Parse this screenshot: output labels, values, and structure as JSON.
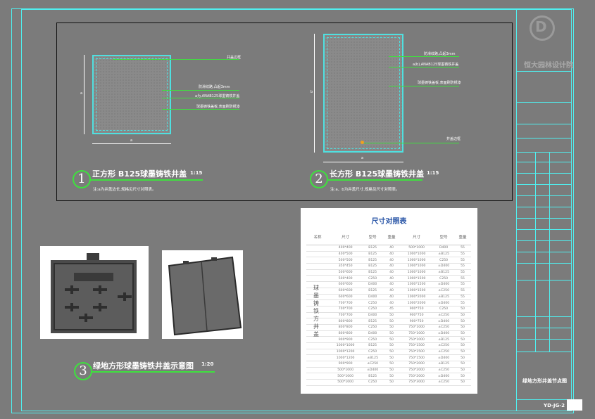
{
  "drawing": {
    "detail1": {
      "number": "1",
      "title": "正方形 B125球墨铸铁井盖",
      "scale": "1:15",
      "note": "注:a为井盖边长,规格见尺寸对照表。",
      "labels": {
        "top": "井盖边框",
        "mid1": "防滑纹路,凸起3mm",
        "mid2": "a为,ANAB125球墨铸铁井盖",
        "mid3": "球墨铸铁盖板,表面刷防锈漆"
      },
      "dims": {
        "side": "a",
        "bottom": "a"
      }
    },
    "detail2": {
      "number": "2",
      "title": "长方形 B125球墨铸铁井盖",
      "scale": "1:15",
      "note": "注:a、b为井盖尺寸,规格见尺寸对照表。",
      "labels": {
        "top": "防滑纹路,凸起3mm",
        "mid1": "a(b),ANAB125球墨铸铁井盖",
        "mid2": "球墨铸铁盖板,表面刷防锈漆",
        "bottom": "井盖边框"
      },
      "dims": {
        "side": "b",
        "bottom": "a"
      }
    },
    "detail3": {
      "number": "3",
      "title": "绿地方形球墨铸铁井盖示意图",
      "scale": "1:20"
    }
  },
  "table": {
    "title": "尺寸对照表",
    "headers": [
      "名称",
      "尺寸",
      "型号",
      "重量",
      "尺寸",
      "型号",
      "重量"
    ],
    "category": "球墨铸铁方井盖",
    "rows": [
      [
        "400*400",
        "B125",
        "40",
        "500*1000",
        "D400",
        "55"
      ],
      [
        "400*500",
        "B125",
        "40",
        "1000*1000",
        "±B125",
        "55"
      ],
      [
        "500*500",
        "B125",
        "40",
        "1000*1000",
        "C250",
        "55"
      ],
      [
        "350*450",
        "B125",
        "40",
        "1000*1000",
        "±D400",
        "55"
      ],
      [
        "500*600",
        "B125",
        "40",
        "1000*1000",
        "±B125",
        "55"
      ],
      [
        "500*400",
        "C250",
        "40",
        "1000*1500",
        "C250",
        "55"
      ],
      [
        "600*600",
        "D400",
        "40",
        "1000*1500",
        "±D400",
        "55"
      ],
      [
        "600*600",
        "B125",
        "40",
        "1000*1500",
        "±C250",
        "55"
      ],
      [
        "600*600",
        "D400",
        "40",
        "1000*2000",
        "±B125",
        "55"
      ],
      [
        "700*700",
        "C250",
        "40",
        "1000*2000",
        "±D400",
        "55"
      ],
      [
        "700*700",
        "C250",
        "45",
        "900*750",
        "C250",
        "50"
      ],
      [
        "700*700",
        "D400",
        "50",
        "900*750",
        "±C250",
        "50"
      ],
      [
        "800*800",
        "B125",
        "50",
        "900*750",
        "±D400",
        "50"
      ],
      [
        "800*800",
        "C250",
        "50",
        "750*1000",
        "±C250",
        "50"
      ],
      [
        "800*800",
        "D400",
        "50",
        "750*1000",
        "±D400",
        "50"
      ],
      [
        "900*900",
        "C250",
        "50",
        "750*1000",
        "±B125",
        "50"
      ],
      [
        "1000*1000",
        "B125",
        "50",
        "750*1500",
        "±C250",
        "50"
      ],
      [
        "1000*1200",
        "C250",
        "50",
        "750*1500",
        "±C250",
        "50"
      ],
      [
        "1000*1200",
        "±B125",
        "50",
        "750*1500",
        "±D400",
        "50"
      ],
      [
        "900*900",
        "±C250",
        "50",
        "750*2000",
        "±B125",
        "50"
      ],
      [
        "500*1000",
        "±D400",
        "50",
        "750*2000",
        "±C250",
        "50"
      ],
      [
        "500*1000",
        "B125",
        "50",
        "750*2000",
        "±D400",
        "50"
      ],
      [
        "500*1000",
        "C250",
        "50",
        "750*3000",
        "±C250",
        "50"
      ]
    ]
  },
  "title_block": {
    "company": "恒大园林设计院",
    "rows": [
      "",
      "",
      "",
      "",
      "",
      "",
      "",
      "",
      "",
      "",
      "",
      "",
      "",
      "",
      "",
      "",
      "",
      "",
      ""
    ],
    "sheet_title": "绿地方形井盖节点图",
    "sheet_no": "YD-JG-2"
  },
  "colors": {
    "cyan": "#4ff0f0",
    "green": "#3ee13e",
    "table_title": "#2a56a7"
  }
}
